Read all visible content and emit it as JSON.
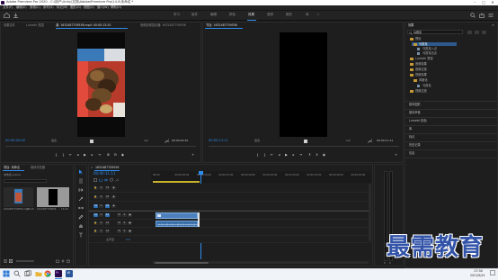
{
  "window": {
    "title": "Adobe Premiere Pro 2020 - C:\\用户\\Unity\\文档\\Adobe\\Premiere Pro\\14.0\\未命名 *"
  },
  "menu": [
    "文件(F)",
    "编辑(E)",
    "剪辑(C)",
    "序列(S)",
    "标记(M)",
    "图形(G)",
    "视图(V)",
    "窗口(W)",
    "帮助(H)"
  ],
  "workspaces": [
    {
      "label": "学习",
      "active": false
    },
    {
      "label": "组件",
      "active": false
    },
    {
      "label": "编辑",
      "active": false
    },
    {
      "label": "颜色",
      "active": false
    },
    {
      "label": "效果",
      "active": true
    },
    {
      "label": "音频",
      "active": false
    },
    {
      "label": "图形",
      "active": false
    },
    {
      "label": "库",
      "active": false
    }
  ],
  "source_monitor": {
    "tabs": [
      {
        "label": "效果控件",
        "active": false
      },
      {
        "label": "Lumetri 范围",
        "active": false
      },
      {
        "label": "源: 1632487709556.mp4: 00:00:13:20",
        "active": true
      },
      {
        "label": "音频剪辑混合器: 1632487709556",
        "active": false
      }
    ],
    "timecode": "00:00:00:00",
    "fit": "适合",
    "quality": "1/2",
    "duration": "00:00:00:10"
  },
  "program_monitor": {
    "tab": "节目: 1632487709556",
    "timecode": "00:00:11:11",
    "fit": "适合",
    "quality": "1/2",
    "duration": "00:00:11:11"
  },
  "effects_panel": {
    "title": "效果",
    "search_value": "马赛克",
    "tree": [
      {
        "label": "预设",
        "level": 0,
        "type": "folder"
      },
      {
        "label": "马赛克",
        "level": 1,
        "type": "folder"
      },
      {
        "label": "马赛克入点",
        "level": 2,
        "type": "item"
      },
      {
        "label": "马赛克出点",
        "level": 2,
        "type": "item"
      },
      {
        "label": "Lumetri 预设",
        "level": 0,
        "type": "folder"
      },
      {
        "label": "音频效果",
        "level": 0,
        "type": "folder"
      },
      {
        "label": "音频过渡",
        "level": 0,
        "type": "folder"
      },
      {
        "label": "视频效果",
        "level": 0,
        "type": "folder"
      },
      {
        "label": "风格化",
        "level": 1,
        "type": "folder"
      },
      {
        "label": "马赛克",
        "level": 2,
        "type": "item"
      },
      {
        "label": "视频过渡",
        "level": 0,
        "type": "folder"
      }
    ],
    "sections": [
      "基本图形",
      "基本声音",
      "Lumetri 颜色",
      "库",
      "标记",
      "历史记录",
      "信息"
    ]
  },
  "project_panel": {
    "tabs": [
      {
        "label": "项目: 未命名",
        "active": true
      },
      {
        "label": "媒体浏览器",
        "active": false
      }
    ],
    "path": "未命名.prproj",
    "items": [
      {
        "name": "1632487709556.mp4",
        "duration": "13:20"
      },
      {
        "name": "1632487709556",
        "duration": "13:20"
      }
    ]
  },
  "timeline": {
    "tab": "1632487709556",
    "timecode": "00:00:11:11",
    "ruler": [
      "00:00",
      "00:00:05:00",
      "00:00:10:00",
      "00:00:15:00",
      "00:00:20:00",
      "00:00:25:00",
      "00:00:30:00",
      "00:00:35:00",
      "00:00:40:00",
      "00:00:45:00"
    ],
    "video_tracks": [
      "V3",
      "V2",
      "V1"
    ],
    "audio_tracks": [
      "A1",
      "A2",
      "A3"
    ],
    "master_label": "主声道",
    "master_value": "0.0"
  },
  "taskbar": {
    "time": "17:34",
    "date": "2021/9/24"
  },
  "watermark": "最需教育",
  "colors": {
    "accent": "#2d8ceb",
    "playhead": "#2d8ceb",
    "clip": "#4d80bd"
  }
}
